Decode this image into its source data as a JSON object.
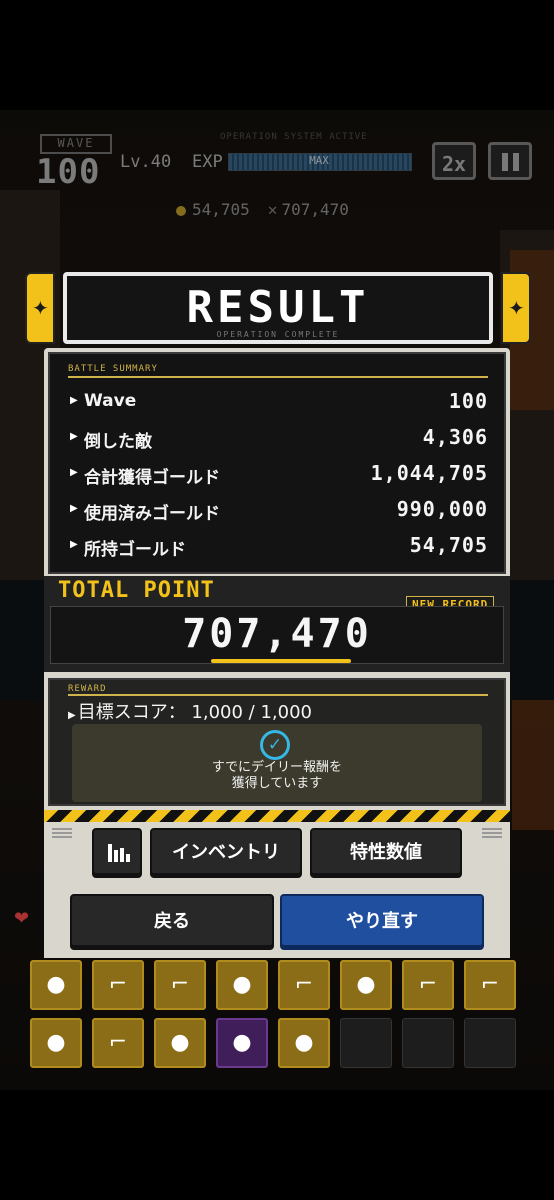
{
  "hud": {
    "wave_label": "WAVE",
    "wave_number": "100",
    "level": "Lv.40",
    "exp_label": "EXP",
    "exp_max": "MAX",
    "operation_status": "OPERATION SYSTEM ACTIVE",
    "speed_label": "2x",
    "gold": "54,705",
    "points": "707,470"
  },
  "result": {
    "title": "RESULT",
    "subtitle": "OPERATION COMPLETE"
  },
  "summary": {
    "label": "BATTLE SUMMARY",
    "rows": [
      {
        "name": "Wave",
        "value": "100"
      },
      {
        "name": "倒した敵",
        "value": "4,306"
      },
      {
        "name": "合計獲得ゴールド",
        "value": "1,044,705"
      },
      {
        "name": "使用済みゴールド",
        "value": "990,000"
      },
      {
        "name": "所持ゴールド",
        "value": "54,705"
      }
    ]
  },
  "total": {
    "label": "TOTAL POINT",
    "badge": "NEW RECORD",
    "value": "707,470"
  },
  "reward": {
    "label": "REWARD",
    "target": "目標スコア： 1,000 / 1,000",
    "daily_line1": "すでにデイリー報酬を",
    "daily_line2": "獲得しています"
  },
  "buttons": {
    "inventory": "インベントリ",
    "traits": "特性数値",
    "back": "戻る",
    "retry": "やり直す"
  },
  "colors": {
    "accent_yellow": "#f2c21a",
    "retry_blue": "#1f4f9e",
    "check_blue": "#36b7e6"
  }
}
